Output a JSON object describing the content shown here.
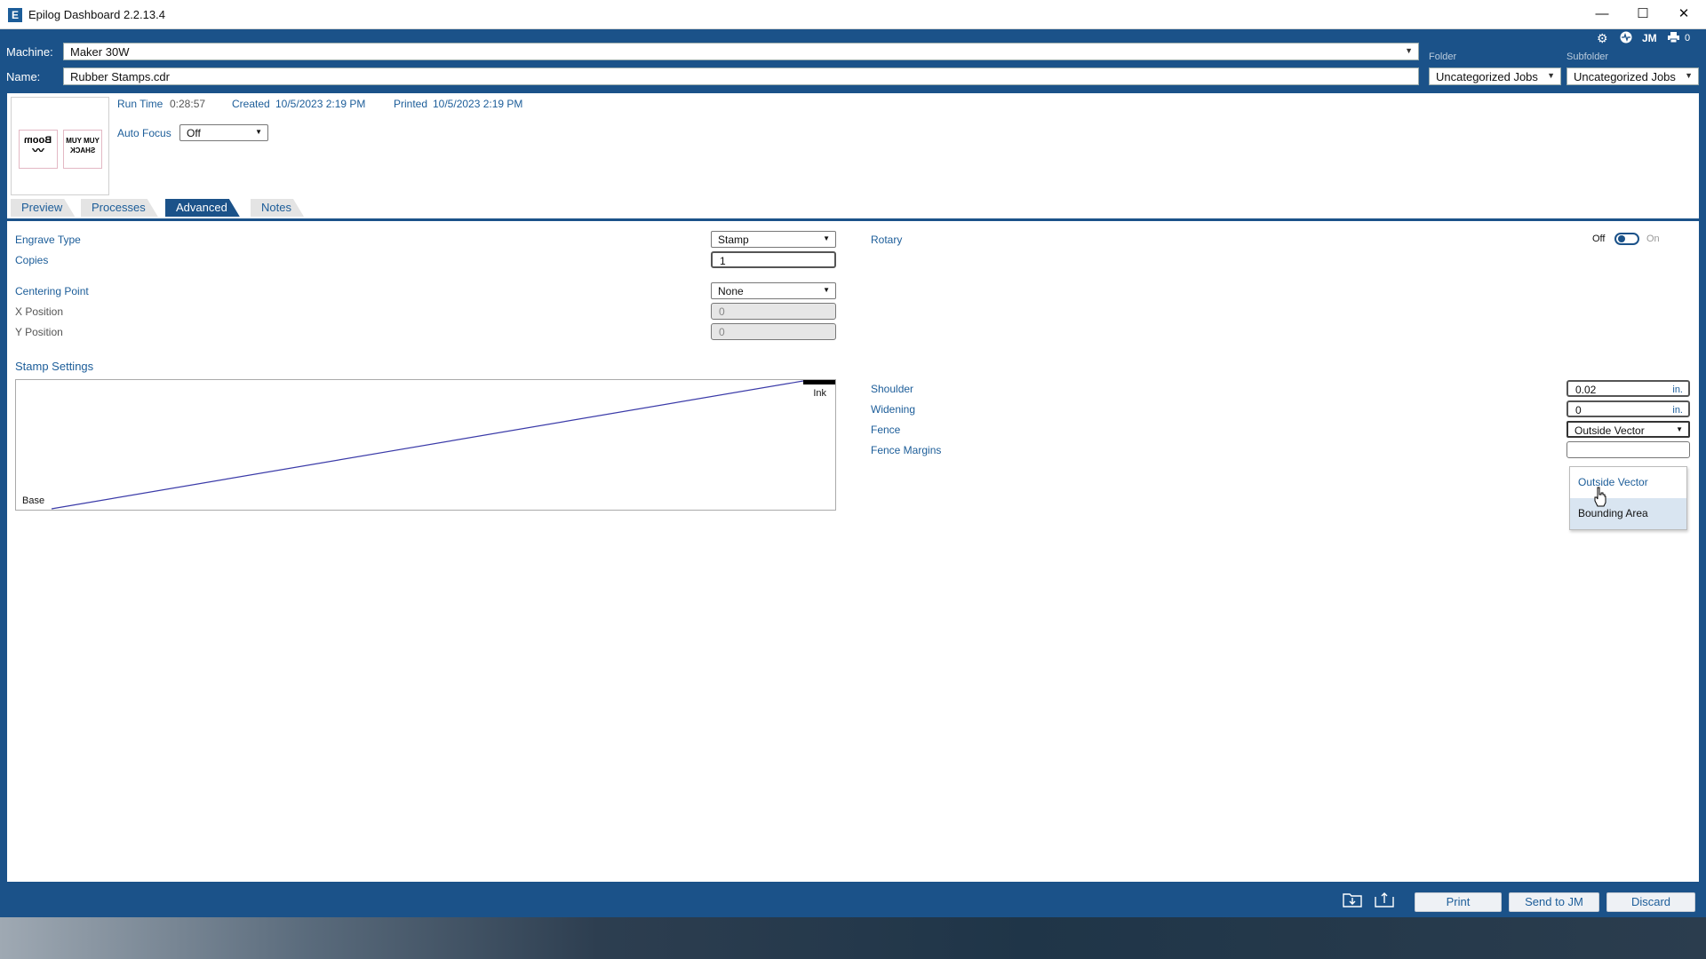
{
  "window": {
    "title": "Epilog Dashboard 2.2.13.4",
    "app_icon": "E",
    "controls": {
      "minimize": "—",
      "maximize": "☐",
      "close": "✕"
    }
  },
  "header": {
    "machine_label": "Machine:",
    "machine_value": "Maker 30W",
    "name_label": "Name:",
    "name_value": "Rubber Stamps.cdr",
    "folder_caption": "Folder",
    "folder_value": "Uncategorized Jobs",
    "subfolder_caption": "Subfolder",
    "subfolder_value": "Uncategorized Jobs",
    "user_initials": "JM",
    "queue_count": "0"
  },
  "job": {
    "thumbnail_1_text": "Boom",
    "thumbnail_2_text": "YUM YUM SHACK",
    "run_time_label": "Run Time",
    "run_time_value": "0:28:57",
    "created_label": "Created",
    "created_value": "10/5/2023 2:19 PM",
    "printed_label": "Printed",
    "printed_value": "10/5/2023 2:19 PM",
    "auto_focus_label": "Auto Focus",
    "auto_focus_value": "Off"
  },
  "tabs": [
    {
      "label": "Preview"
    },
    {
      "label": "Processes"
    },
    {
      "label": "Advanced"
    },
    {
      "label": "Notes"
    }
  ],
  "advanced": {
    "engrave_type_label": "Engrave Type",
    "engrave_type_value": "Stamp",
    "copies_label": "Copies",
    "copies_value": "1",
    "centering_point_label": "Centering Point",
    "centering_point_value": "None",
    "x_position_label": "X Position",
    "x_position_value": "0",
    "y_position_label": "Y Position",
    "y_position_value": "0",
    "stamp_settings_label": "Stamp Settings",
    "stamp_ink_label": "Ink",
    "stamp_base_label": "Base",
    "rotary_label": "Rotary",
    "rotary_off": "Off",
    "rotary_on": "On",
    "shoulder_label": "Shoulder",
    "shoulder_value": "0.02",
    "shoulder_unit": "in.",
    "widening_label": "Widening",
    "widening_value": "0",
    "widening_unit": "in.",
    "fence_label": "Fence",
    "fence_value": "Outside Vector",
    "fence_margins_label": "Fence Margins",
    "fence_options": [
      "Outside Vector",
      "Bounding Area"
    ]
  },
  "footer": {
    "print_label": "Print",
    "send_label": "Send to JM",
    "discard_label": "Discard"
  },
  "colors": {
    "brand_blue": "#1b5289",
    "link_blue": "#1c5d99",
    "stamp_line": "#3a3aa8"
  }
}
